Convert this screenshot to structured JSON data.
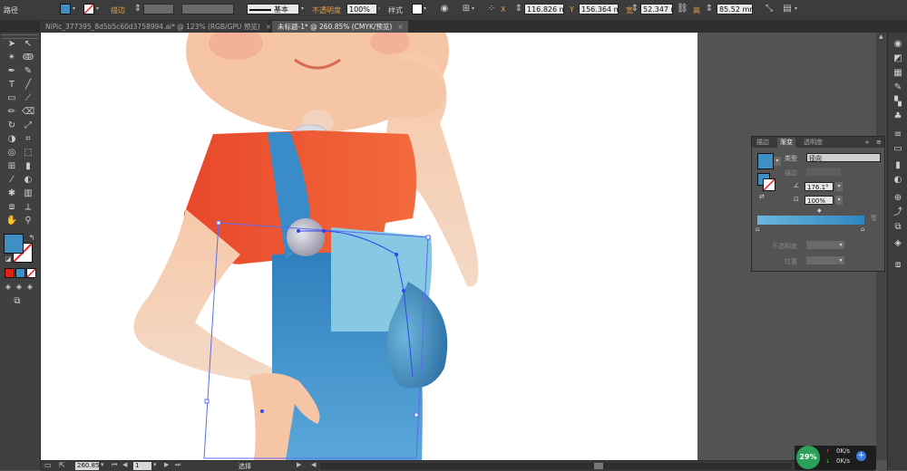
{
  "control_bar": {
    "mode_label": "路径",
    "stroke_label": "描边",
    "stroke_profile": "基本",
    "opacity_label": "不透明度",
    "opacity_value": "100%",
    "style_label": "样式",
    "x_label": "X",
    "x_value": "116.826 m",
    "y_label": "Y",
    "y_value": "156.364 m",
    "w_label": "宽",
    "w_value": "52.347 mm",
    "h_label": "高",
    "h_value": "85.52 mm",
    "fill_color": "#3f8fc4"
  },
  "tabs": [
    {
      "label": "NiPic_377395_8d5b5c60d3758994.ai* @ 123% (RGB/GPU 预览)",
      "active": false
    },
    {
      "label": "未标题-1* @ 260.85% (CMYK/预览)",
      "active": true
    }
  ],
  "tools": {
    "fill_color": "#3f8fc4",
    "stroke_color": "#ffffff",
    "icons": [
      "selection-icon",
      "direct-selection-icon",
      "magic-wand-icon",
      "lasso-icon",
      "pen-icon",
      "curvature-icon",
      "type-icon",
      "line-icon",
      "rectangle-icon",
      "paintbrush-icon",
      "pencil-icon",
      "eraser-icon",
      "rotate-icon",
      "scale-icon",
      "warp-icon",
      "free-transform-icon",
      "shape-builder-icon",
      "perspective-icon",
      "mesh-icon",
      "gradient-icon",
      "eyedropper-icon",
      "blend-icon",
      "symbol-sprayer-icon",
      "graph-icon",
      "artboard-icon",
      "slice-icon",
      "hand-icon",
      "zoom-icon"
    ]
  },
  "gradient_panel": {
    "tabs": [
      "描边",
      "渐变",
      "透明度"
    ],
    "active_tab": "渐变",
    "type_label": "类型",
    "type_value": "径向",
    "stroke_label": "描边",
    "angle_value": "176.1°",
    "aspect_value": "100%",
    "stop_opacity_label": "不透明度",
    "location_label": "位置",
    "gradient_start": "#6cb6dc",
    "gradient_end": "#2f86c0"
  },
  "status_bar": {
    "zoom": "260.85",
    "artboard_number": "1",
    "tool_status": "选择"
  },
  "network_widget": {
    "percent": "29%",
    "upload": "0K/s",
    "download": "0K/s"
  }
}
